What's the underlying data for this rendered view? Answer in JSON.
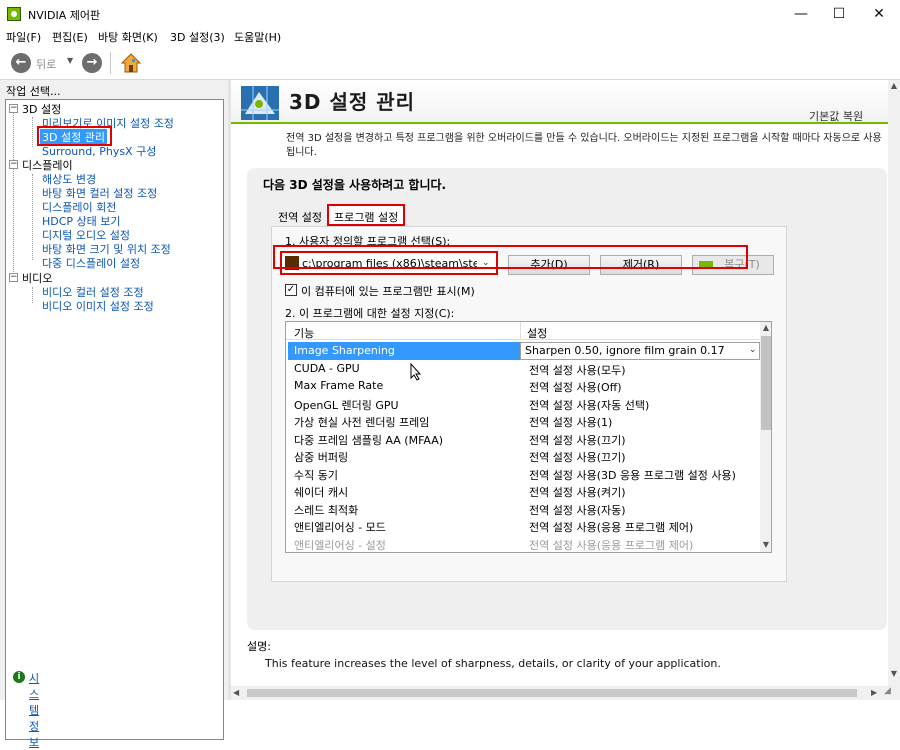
{
  "window": {
    "title": "NVIDIA 제어판",
    "minimize": "—",
    "maximize": "☐",
    "close": "✕"
  },
  "menubar": {
    "items": [
      "파일(F)",
      "편집(E)",
      "바탕 화면(K)",
      "3D 설정(3)",
      "도움말(H)"
    ]
  },
  "toolbar": {
    "back_label": "뒤로",
    "back_glyph": "←",
    "forward_glyph": "→",
    "dropdown_glyph": "▼"
  },
  "sidebar": {
    "header": "작업 선택...",
    "categories": [
      {
        "label": "3D 설정",
        "expander": "−",
        "items": [
          "미리보기로 이미지 설정 조정",
          "3D 설정 관리",
          "Surround, PhysX 구성"
        ]
      },
      {
        "label": "디스플레이",
        "expander": "−",
        "items": [
          "해상도 변경",
          "바탕 화면 컬러 설정 조정",
          "디스플레이 회전",
          "HDCP 상태 보기",
          "디지털 오디오 설정",
          "바탕 화면 크기 및 위치 조정",
          "다중 디스플레이 설정"
        ]
      },
      {
        "label": "비디오",
        "expander": "−",
        "items": [
          "비디오 컬러 설정 조정",
          "비디오 이미지 설정 조정"
        ]
      }
    ],
    "system_info": "시스템 정보",
    "system_info_glyph": "i"
  },
  "page": {
    "title": "3D 설정 관리",
    "restore_defaults": "기본값 복원",
    "description": "전역 3D 설정을 변경하고 특정 프로그램을 위한 오버라이드를 만들 수 있습니다. 오버라이드는 지정된 프로그램을 시작할 때마다 자동으로 사용됩니다.",
    "settings_heading": "다음 3D 설정을 사용하려고 합니다.",
    "tabs": [
      "전역 설정",
      "프로그램 설정"
    ],
    "step1": "1. 사용자 정의할 프로그램 선택(S):",
    "program_selected": "c:\\program files (x86)\\steam\\ste...",
    "buttons": {
      "add": "추가(D)",
      "remove": "제거(R)",
      "restore": "복구(T)"
    },
    "checkbox_label": "이 컴퓨터에 있는 프로그램만 표시(M)",
    "checkbox_checked": "✓",
    "step2": "2. 이 프로그램에 대한 설정 지정(C):",
    "grid": {
      "col_feature": "기능",
      "col_setting": "설정",
      "rows": [
        {
          "feature": "Image Sharpening",
          "setting": "Sharpen 0.50, ignore film grain 0.17"
        },
        {
          "feature": "CUDA - GPU",
          "setting": "전역 설정 사용(모두)"
        },
        {
          "feature": "Max Frame Rate",
          "setting": "전역 설정 사용(Off)"
        },
        {
          "feature": "OpenGL 렌더링 GPU",
          "setting": "전역 설정 사용(자동 선택)"
        },
        {
          "feature": "가상 현실 사전 렌더링 프레임",
          "setting": "전역 설정 사용(1)"
        },
        {
          "feature": "다중 프레임 샘플링 AA (MFAA)",
          "setting": "전역 설정 사용(끄기)"
        },
        {
          "feature": "삼중 버퍼링",
          "setting": "전역 설정 사용(끄기)"
        },
        {
          "feature": "수직 동기",
          "setting": "전역 설정 사용(3D 응용 프로그램 설정 사용)"
        },
        {
          "feature": "쉐이더 캐시",
          "setting": "전역 설정 사용(켜기)"
        },
        {
          "feature": "스레드 최적화",
          "setting": "전역 설정 사용(자동)"
        },
        {
          "feature": "앤티엘리어싱 - 모드",
          "setting": "전역 설정 사용(응용 프로그램 제어)"
        },
        {
          "feature": "앤티엘리어싱 - 설정",
          "setting": "전역 설정 사용(응용 프로그램 제어)"
        }
      ]
    },
    "desc_label": "설명:",
    "desc_text": "This feature increases the level of sharpness, details, or clarity of your application."
  },
  "colors": {
    "nvidia_green": "#76b900",
    "highlight": "#e00000",
    "selection": "#3399ff",
    "link": "#0b56b3"
  }
}
